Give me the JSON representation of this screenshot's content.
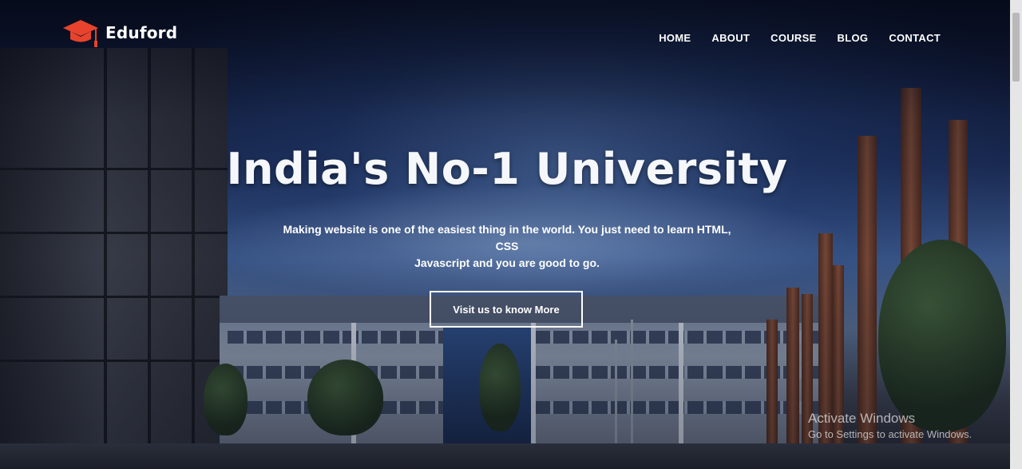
{
  "brand": {
    "name": "Eduford",
    "logo_icon": "graduation-cap-icon",
    "logo_color": "#e8432d"
  },
  "nav": {
    "items": [
      {
        "label": "HOME"
      },
      {
        "label": "ABOUT"
      },
      {
        "label": "COURSE"
      },
      {
        "label": "BLOG"
      },
      {
        "label": "CONTACT"
      }
    ]
  },
  "hero": {
    "title": "India's No-1 University",
    "subtitle_line1": "Making website is one of the easiest thing in the world. You just need to learn HTML, CSS",
    "subtitle_line2": "Javascript and you are good to go.",
    "cta_label": "Visit us to know More"
  },
  "system_watermark": {
    "title": "Activate Windows",
    "subtitle": "Go to Settings to activate Windows."
  }
}
